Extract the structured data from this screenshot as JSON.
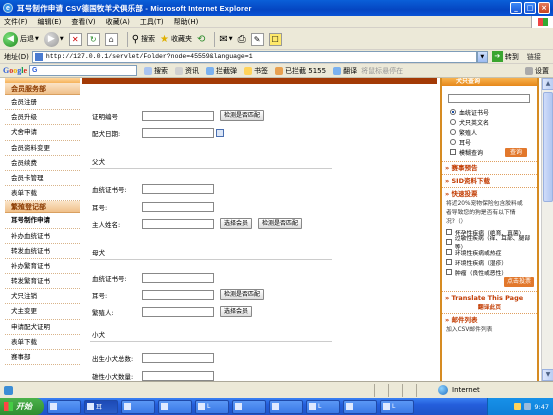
{
  "window": {
    "title": "耳号制作申请 CSV德国牧羊犬俱乐部 - Microsoft Internet Explorer",
    "minimize": "_",
    "maximize": "□",
    "close": "×"
  },
  "menu": [
    "文件(F)",
    "编辑(E)",
    "查看(V)",
    "收藏(A)",
    "工具(T)",
    "帮助(H)"
  ],
  "toolbar": {
    "back": "后退",
    "search": "搜索",
    "favorites": "收藏夹"
  },
  "address": {
    "label": "地址(D)",
    "url": "http://127.0.0.1/servlet/Folder?node=45559&language=1",
    "go": "转到",
    "links": "链接"
  },
  "googlebar": {
    "logo": [
      "G",
      "o",
      "o",
      "g",
      "l",
      "e"
    ],
    "search_prefix": "G",
    "items": [
      "搜索",
      "资讯",
      "拦截弹",
      "书签",
      "已拦截 5155",
      "翻译"
    ],
    "translate_hint": "将鼠标悬停在",
    "settings": "设置"
  },
  "sidebar": {
    "section1": "会员服务部",
    "items1": [
      "会员注册",
      "会员升级",
      "犬舍申请",
      "会员资料变更",
      "会员续费",
      "会员卡管理",
      "表单下载"
    ],
    "section2": "繁殖登记部",
    "items2": [
      "耳号制作申请",
      "补办血统证书",
      "转发血统证书",
      "补办繁育证书",
      "转发繁育证书",
      "犬只注销",
      "犬主变更",
      "申请配犬证明",
      "表单下载",
      "赛事部"
    ]
  },
  "form": {
    "cert_label": "证明编号",
    "cert_check": "检测是否匹配",
    "date_label": "配犬日期:",
    "sire_section": "父犬",
    "sire_cert": "血统证书号:",
    "sire_ear": "耳号:",
    "sire_owner": "主人姓名:",
    "select_member": "选择会员",
    "check_match": "检测是否匹配",
    "dam_section": "母犬",
    "dam_cert": "血统证书号:",
    "dam_ear": "耳号:",
    "dam_check": "检测是否匹配",
    "breeder": "繁殖人:",
    "breeder_select": "选择会员",
    "puppy_section": "小犬",
    "puppy_total": "出生小犬总数:",
    "puppy_male": "雄性小犬数量:"
  },
  "rightpanel": {
    "header": "犬只查询",
    "radio": [
      "血统证书号",
      "犬只英文名",
      "繁殖人",
      "耳号"
    ],
    "fuzzy": "模糊查询",
    "query_btn": "查询",
    "sec_competition": "赛事预告",
    "sec_sid": "SID资料下载",
    "sec_vote": "快速投票",
    "vote_q1": "将近20%宠物保险包含胶料或",
    "vote_q2": "者导致您的狗是否有以下情",
    "vote_q3": "况?（）",
    "options": [
      "怀孕性疾病（绝育、真菌）",
      "过敏性疾病（痒、耳部、腿部等）",
      "环境性疾病或热症",
      "环境性疾病（湿疹）",
      "肿瘤（良性或恶性）"
    ],
    "vote_btn": "点击投票",
    "sec_translate": "Translate This Page",
    "translate_sub": "翻译此页",
    "sec_mail": "邮件列表",
    "mail_text": "加入CSV邮件列表"
  },
  "status": {
    "done": "",
    "zone": "Internet"
  },
  "taskbar": {
    "start": "开始",
    "buttons": [
      "",
      "耳",
      "",
      "",
      "L",
      "",
      "",
      "L",
      "",
      "L",
      "",
      ""
    ],
    "time": "9:47"
  }
}
